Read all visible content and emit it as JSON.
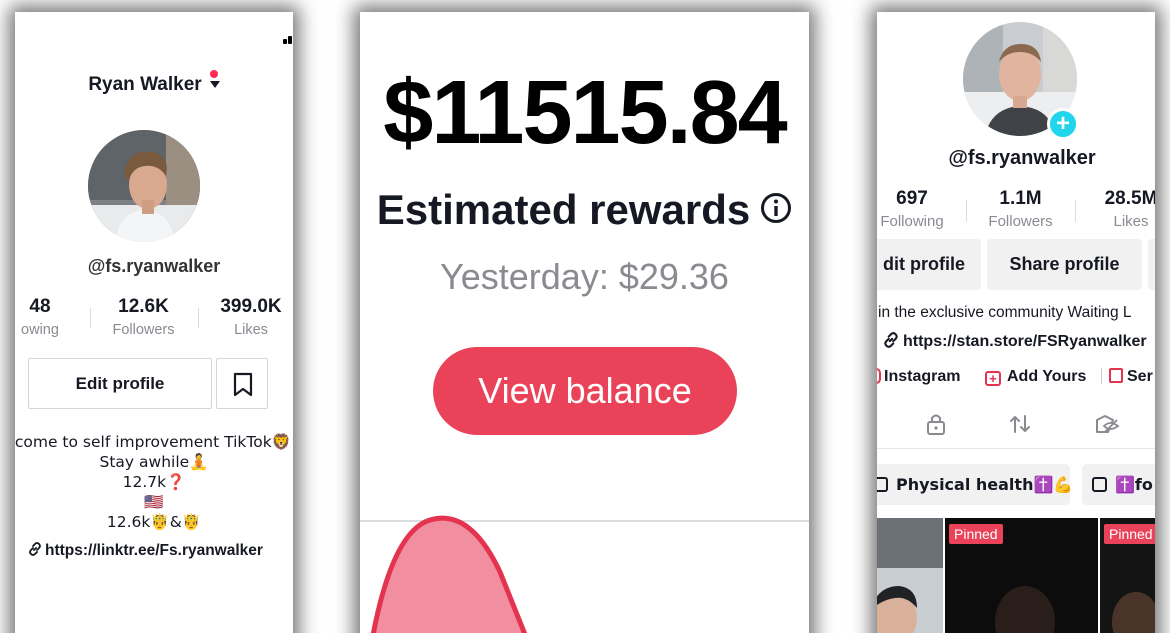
{
  "left": {
    "title": "Ryan Walker",
    "handle": "@fs.ryanwalker",
    "stats": [
      {
        "num": "48",
        "label": "owing"
      },
      {
        "num": "12.6K",
        "label": "Followers"
      },
      {
        "num": "399.0K",
        "label": "Likes"
      }
    ],
    "edit_label": "Edit profile",
    "bio_lines": [
      "elcome to self improvement TikTok🦁",
      "Stay awhile🧘",
      "12.7k❓",
      "🇺🇸",
      "12.6k🤴&🤴"
    ],
    "link": "https://linktr.ee/Fs.ryanwalker"
  },
  "middle": {
    "amount": "$11515.84",
    "estimated_label": "Estimated rewards",
    "yesterday": "Yesterday: $29.36",
    "button_label": "View balance",
    "accent": "#ea4359"
  },
  "right": {
    "handle": "@fs.ryanwalker",
    "stats": [
      {
        "num": "697",
        "label": "Following"
      },
      {
        "num": "1.1M",
        "label": "Followers"
      },
      {
        "num": "28.5M",
        "label": "Likes"
      }
    ],
    "edit_label": "dit profile",
    "share_label": "Share profile",
    "bio": "in the exclusive community Waiting L",
    "link": "https://stan.store/FSRyanwalker",
    "links": [
      "Instagram",
      "Add Yours",
      "Ser"
    ],
    "playlists": [
      "Physical health✝️💪",
      "✝️fo"
    ],
    "pinned_label": "Pinned",
    "tab_icons": [
      "lock-icon",
      "repost-icon",
      "liked-hidden-icon"
    ]
  }
}
